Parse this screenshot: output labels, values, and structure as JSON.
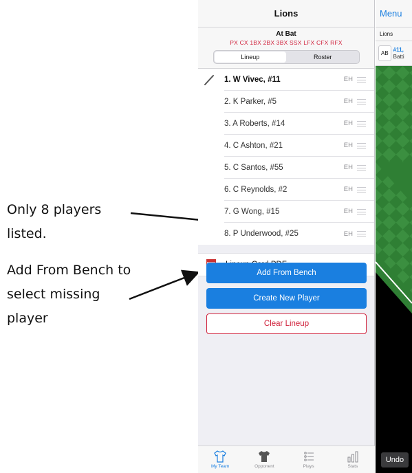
{
  "annotations": {
    "note1_line1": "Only 8 players",
    "note1_line2": "listed.",
    "note2_line1": "Add From Bench to",
    "note2_line2": "select missing",
    "note2_line3": "player"
  },
  "panel": {
    "title": "Lions",
    "at_bat_title": "At Bat",
    "positions": "PX  CX  1BX  2BX  3BX  SSX  LFX  CFX  RFX",
    "segments": [
      "Lineup",
      "Roster"
    ],
    "active_segment": "Lineup"
  },
  "lineup": [
    {
      "name": "1. W Vivec, #11",
      "pos": "EH"
    },
    {
      "name": "2. K Parker, #5",
      "pos": "EH"
    },
    {
      "name": "3. A Roberts, #14",
      "pos": "EH"
    },
    {
      "name": "4. C Ashton, #21",
      "pos": "EH"
    },
    {
      "name": "5. C Santos, #55",
      "pos": "EH"
    },
    {
      "name": "6. C Reynolds, #2",
      "pos": "EH"
    },
    {
      "name": "7. G Wong, #15",
      "pos": "EH"
    },
    {
      "name": "8. P Underwood, #25",
      "pos": "EH"
    }
  ],
  "pdf_row": {
    "label": "Lineup Card PDF"
  },
  "buttons": {
    "add_from_bench": "Add From Bench",
    "create_new_player": "Create New Player",
    "clear_lineup": "Clear Lineup"
  },
  "tabs": [
    {
      "label": "My Team",
      "icon": "jersey-outline-icon",
      "active": true
    },
    {
      "label": "Opponent",
      "icon": "jersey-filled-icon",
      "active": false
    },
    {
      "label": "Plays",
      "icon": "list-icon",
      "active": false
    },
    {
      "label": "Stats",
      "icon": "bar-chart-icon",
      "active": false
    }
  ],
  "right_panel": {
    "menu": "Menu",
    "team": "Lions",
    "ab_badge": "AB",
    "ab_player": "#11,",
    "ab_status": "Batti",
    "undo": "Undo"
  },
  "colors": {
    "accent_blue": "#1a7fe0",
    "danger_red": "#d0223c",
    "field_green": "#2f7f34"
  }
}
